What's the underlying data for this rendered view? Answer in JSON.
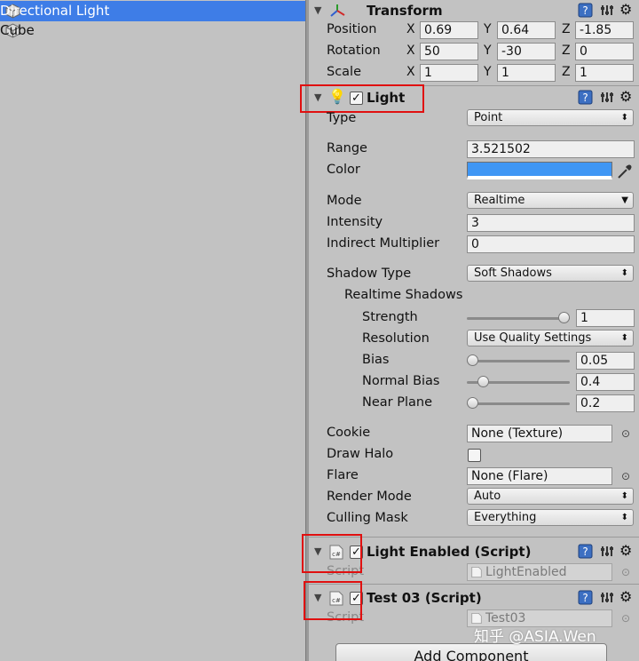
{
  "hierarchy": {
    "items": [
      {
        "label": "Directional Light",
        "selected": true
      },
      {
        "label": "Cube",
        "selected": false
      }
    ]
  },
  "transform": {
    "title": "Transform",
    "position": {
      "label": "Position",
      "x": "0.69",
      "y": "0.64",
      "z": "-1.85"
    },
    "rotation": {
      "label": "Rotation",
      "x": "50",
      "y": "-30",
      "z": "0"
    },
    "scale": {
      "label": "Scale",
      "x": "1",
      "y": "1",
      "z": "1"
    },
    "axis": {
      "x": "X",
      "y": "Y",
      "z": "Z"
    }
  },
  "light": {
    "title": "Light",
    "enabled": true,
    "type": {
      "label": "Type",
      "value": "Point"
    },
    "range": {
      "label": "Range",
      "value": "3.521502"
    },
    "color": {
      "label": "Color",
      "value": "#3f96f4"
    },
    "mode": {
      "label": "Mode",
      "value": "Realtime"
    },
    "intensity": {
      "label": "Intensity",
      "value": "3"
    },
    "indirect": {
      "label": "Indirect Multiplier",
      "value": "0"
    },
    "shadow_type": {
      "label": "Shadow Type",
      "value": "Soft Shadows"
    },
    "realtime_shadows": "Realtime Shadows",
    "strength": {
      "label": "Strength",
      "value": "1",
      "fraction": 1.0
    },
    "resolution": {
      "label": "Resolution",
      "value": "Use Quality Settings"
    },
    "bias": {
      "label": "Bias",
      "value": "0.05",
      "fraction": 0.0
    },
    "normal_bias": {
      "label": "Normal Bias",
      "value": "0.4",
      "fraction": 0.12
    },
    "near_plane": {
      "label": "Near Plane",
      "value": "0.2",
      "fraction": 0.0
    },
    "cookie": {
      "label": "Cookie",
      "value": "None (Texture)"
    },
    "draw_halo": {
      "label": "Draw Halo",
      "checked": false
    },
    "flare": {
      "label": "Flare",
      "value": "None (Flare)"
    },
    "render_mode": {
      "label": "Render Mode",
      "value": "Auto"
    },
    "culling_mask": {
      "label": "Culling Mask",
      "value": "Everything"
    }
  },
  "light_enabled_script": {
    "title": "Light Enabled (Script)",
    "enabled": true,
    "script_label": "Script",
    "script_value": "LightEnabled"
  },
  "test03_script": {
    "title": "Test 03 (Script)",
    "enabled": true,
    "script_label": "Script",
    "script_value": "Test03"
  },
  "add_component": "Add Component",
  "watermark": "知乎 @ASIA.Wen",
  "colors": {
    "selection": "#3e7de7",
    "highlight_box": "#e01010",
    "panel": "#c2c2c2"
  }
}
